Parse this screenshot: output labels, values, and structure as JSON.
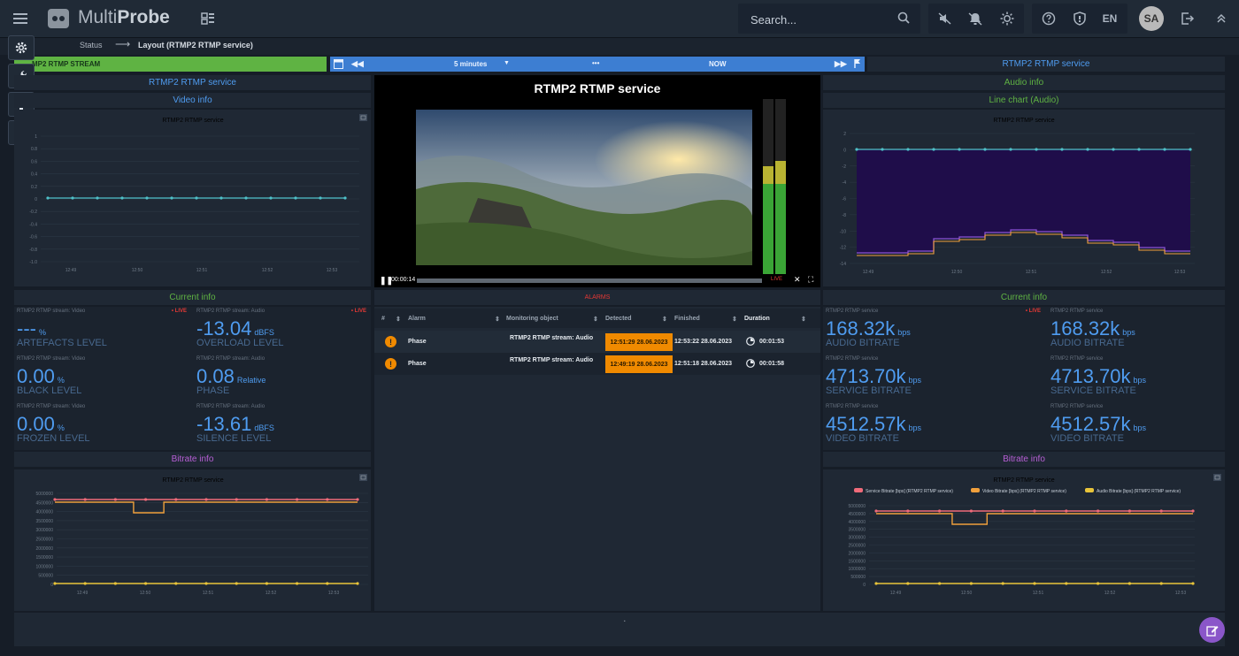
{
  "app": {
    "brand_a": "Multi",
    "brand_b": "Probe"
  },
  "search": {
    "placeholder": "Search..."
  },
  "header": {
    "lang": "EN",
    "user_initials": "SA"
  },
  "breadcrumb": {
    "root": "Status",
    "arrow": "⟶",
    "current": "Layout (RTMP2 RTMP service)"
  },
  "timeline": {
    "stream_label": "MP2 RTMP STREAM",
    "range": "5 minutes",
    "now": "NOW",
    "dots": "•••",
    "service_label": "RTMP2 RTMP service"
  },
  "left": {
    "service_title": "RTMP2 RTMP service",
    "video_info_title": "Video info",
    "video_chart": {
      "title": "RTMP2 RTMP service",
      "y_ticks": [
        "1",
        "0.8",
        "0.6",
        "0.4",
        "0.2",
        "0",
        "-0.2",
        "-0.4",
        "-0.6",
        "-0.8",
        "-1.0"
      ],
      "x_ticks": [
        "12:49",
        "12:50",
        "12:51",
        "12:52",
        "12:53"
      ]
    },
    "current_info_title": "Current info",
    "current_info": [
      {
        "source": "RTMP2 RTMP stream: Video",
        "live": "• LIVE",
        "value": "---",
        "unit": "%",
        "name": "ARTEFACTS LEVEL"
      },
      {
        "source": "RTMP2 RTMP stream: Audio",
        "live": "• LIVE",
        "value": "-13.04",
        "unit": "dBFS",
        "name": "OVERLOAD LEVEL"
      },
      {
        "source": "RTMP2 RTMP stream: Video",
        "live": "",
        "value": "0.00",
        "unit": "%",
        "name": "BLACK LEVEL"
      },
      {
        "source": "RTMP2 RTMP stream: Audio",
        "live": "",
        "value": "0.08",
        "unit": "Relative",
        "name": "PHASE"
      },
      {
        "source": "RTMP2 RTMP stream: Video",
        "live": "",
        "value": "0.00",
        "unit": "%",
        "name": "FROZEN LEVEL"
      },
      {
        "source": "RTMP2 RTMP stream: Audio",
        "live": "",
        "value": "-13.61",
        "unit": "dBFS",
        "name": "SILENCE LEVEL"
      }
    ],
    "bitrate_info_title": "Bitrate info",
    "bitrate_chart": {
      "title": "RTMP2 RTMP service",
      "y_ticks": [
        "5000000",
        "4500000",
        "4000000",
        "3500000",
        "3000000",
        "2500000",
        "2000000",
        "1500000",
        "1000000",
        "500000",
        "0"
      ],
      "x_ticks": [
        "12:49",
        "12:50",
        "12:51",
        "12:52",
        "12:53"
      ]
    }
  },
  "center": {
    "player_title": "RTMP2 RTMP service",
    "player_time": "00:00:14",
    "live": "LIVE",
    "alarms_title": "ALARMS",
    "alarm_headers": {
      "num": "#",
      "alarm": "Alarm",
      "object": "Monitoring object",
      "detected": "Detected",
      "finished": "Finished",
      "duration": "Duration"
    },
    "alarms": [
      {
        "alarm": "Phase",
        "object": "RTMP2 RTMP stream: Audio",
        "detected": "12:51:29  28.06.2023",
        "finished": "12:53:22 28.06.2023",
        "duration": "00:01:53"
      },
      {
        "alarm": "Phase",
        "object": "RTMP2 RTMP stream: Audio",
        "detected": "12:49:19  28.06.2023",
        "finished": "12:51:18 28.06.2023",
        "duration": "00:01:58"
      }
    ]
  },
  "right": {
    "audio_info_title": "Audio info",
    "line_chart_title": "Line chart (Audio)",
    "audio_chart": {
      "title": "RTMP2 RTMP service",
      "y_ticks": [
        "2",
        "0",
        "-2",
        "-4",
        "-6",
        "-8",
        "-10",
        "-12",
        "-14"
      ],
      "x_ticks": [
        "12:49",
        "12:50",
        "12:51",
        "12:52",
        "12:53"
      ]
    },
    "current_info_title": "Current info",
    "current_info": [
      {
        "source": "RTMP2 RTMP service",
        "live": "• LIVE",
        "value": "168.32k",
        "unit": "bps",
        "name": "AUDIO BITRATE"
      },
      {
        "source": "RTMP2 RTMP service",
        "live": "• LIVE",
        "value": "168.32k",
        "unit": "bps",
        "name": "AUDIO BITRATE"
      },
      {
        "source": "RTMP2 RTMP service",
        "live": "",
        "value": "4713.70k",
        "unit": "bps",
        "name": "SERVICE BITRATE"
      },
      {
        "source": "RTMP2 RTMP service",
        "live": "",
        "value": "4713.70k",
        "unit": "bps",
        "name": "SERVICE BITRATE"
      },
      {
        "source": "RTMP2 RTMP service",
        "live": "",
        "value": "4512.57k",
        "unit": "bps",
        "name": "VIDEO BITRATE"
      },
      {
        "source": "RTMP2 RTMP service",
        "live": "",
        "value": "4512.57k",
        "unit": "bps",
        "name": "VIDEO BITRATE"
      }
    ],
    "bitrate_info_title": "Bitrate info",
    "bitrate_chart": {
      "title": "RTMP2 RTMP service",
      "legend": [
        "Service Bitrate [bps] (RTMP2 RTMP service)",
        "Video Bitrate [bps] (RTMP2 RTMP service)",
        "Audio Bitrate [bps] (RTMP2 RTMP service)"
      ],
      "y_ticks": [
        "5000000",
        "4500000",
        "4000000",
        "3500000",
        "3000000",
        "2500000",
        "2000000",
        "1500000",
        "1000000",
        "500000",
        "0"
      ],
      "x_ticks": [
        "12:49",
        "12:50",
        "12:51",
        "12:52",
        "12:53"
      ]
    }
  },
  "colors": {
    "accent_blue": "#4f9cf0",
    "green": "#5fb343",
    "purple": "#b85fd6",
    "orange": "#f08a00",
    "service": "#f06b7a",
    "video": "#f0a03c",
    "audio": "#e8c43a",
    "teal": "#4fc1c9"
  }
}
